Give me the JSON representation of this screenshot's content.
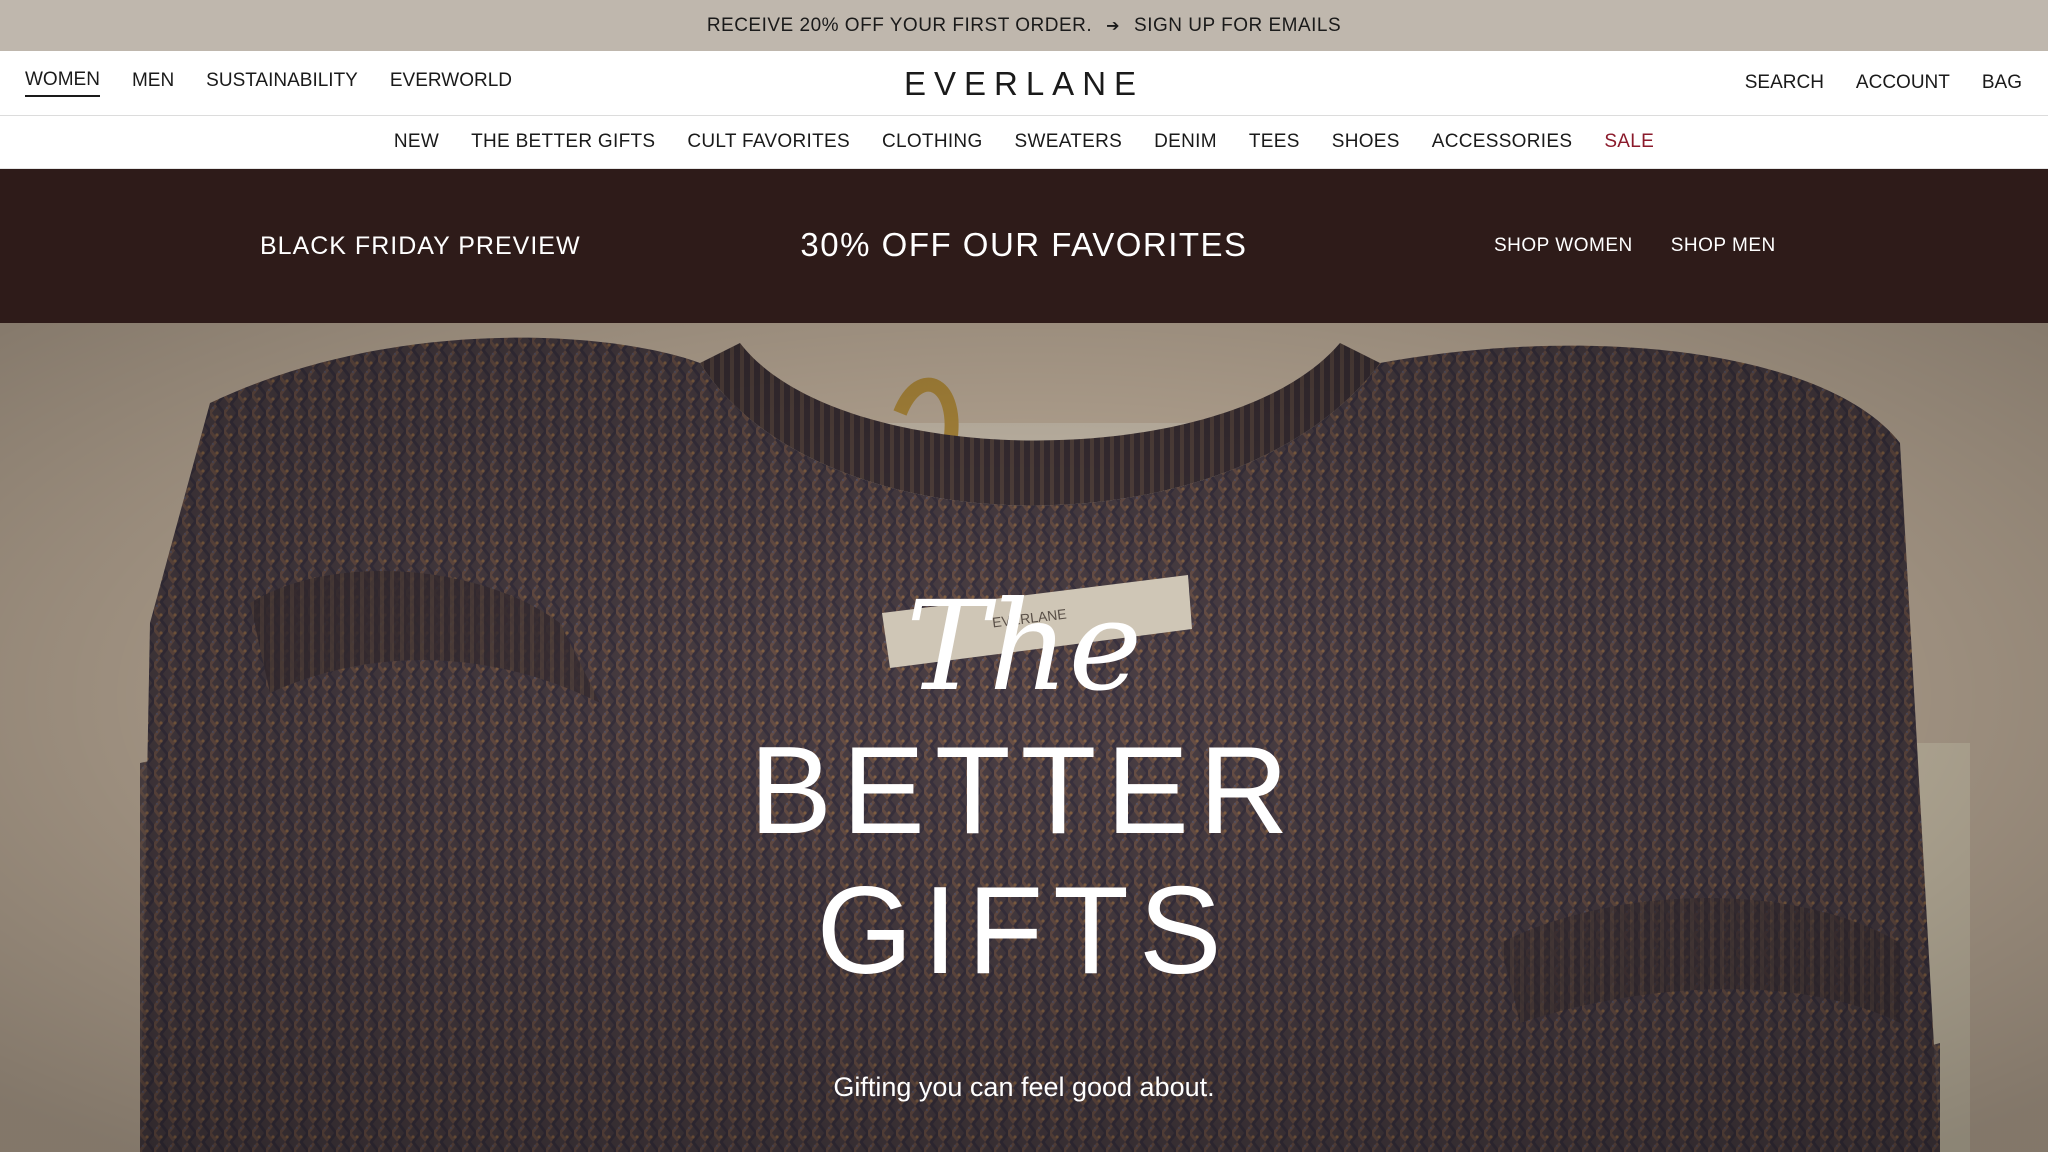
{
  "announcement": {
    "text": "RECEIVE 20% OFF YOUR FIRST ORDER.",
    "arrow": "➔",
    "link": "SIGN UP FOR EMAILS"
  },
  "header": {
    "left_nav": [
      "WOMEN",
      "MEN",
      "SUSTAINABILITY",
      "EVERWORLD"
    ],
    "active": "WOMEN",
    "logo": "EVERLANE",
    "right_nav": [
      "SEARCH",
      "ACCOUNT",
      "BAG"
    ]
  },
  "categories": [
    "NEW",
    "THE BETTER GIFTS",
    "CULT FAVORITES",
    "CLOTHING",
    "SWEATERS",
    "DENIM",
    "TEES",
    "SHOES",
    "ACCESSORIES",
    "SALE"
  ],
  "promo": {
    "left": "BLACK FRIDAY PREVIEW",
    "center": "30% OFF OUR FAVORITES",
    "shop_women": "SHOP WOMEN",
    "shop_men": "SHOP MEN"
  },
  "hero": {
    "the": "The",
    "better": "BETTER",
    "gifts": "GIFTS",
    "tagline": "Gifting you can feel good about.",
    "image": "knit-sweater-in-gift-box",
    "label_text": "EVERLANE"
  },
  "colors": {
    "announcement_bg": "#bfb7ad",
    "promo_bg": "#2e1b19",
    "sale": "#8b1a2b",
    "sweater": "#4a3c3f"
  }
}
